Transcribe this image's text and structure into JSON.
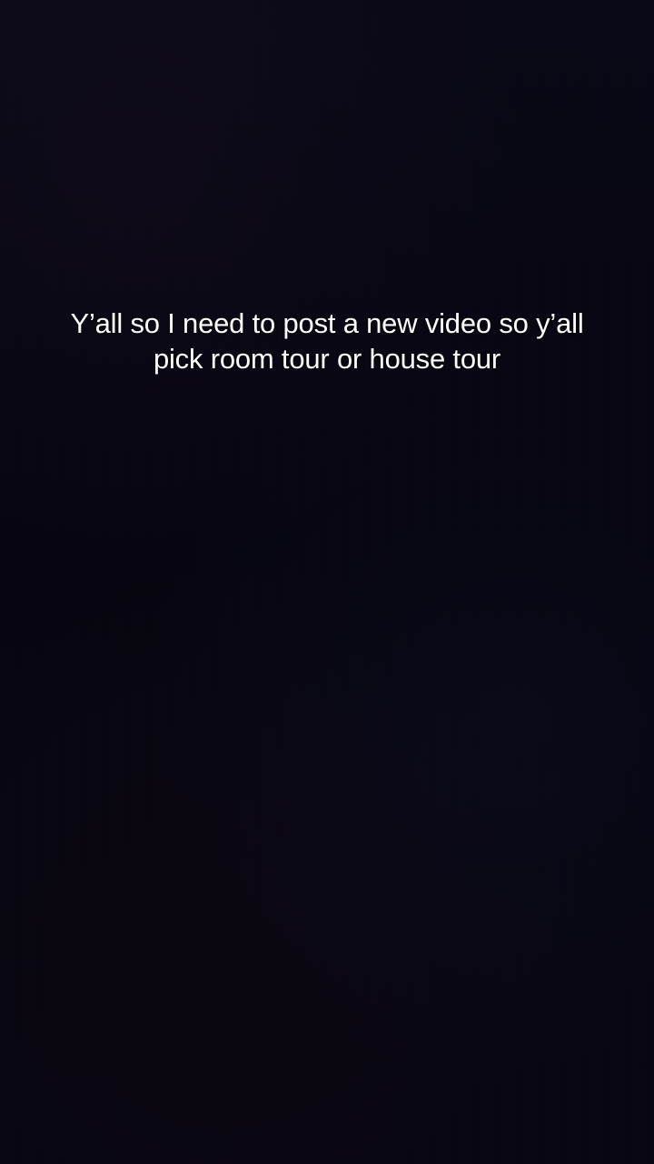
{
  "story": {
    "caption_lines": [
      "Y’all so I need to post a new video so y’all",
      "pick room tour or house tour"
    ]
  },
  "colors": {
    "background": "#07060f",
    "text": "#ffffff"
  }
}
